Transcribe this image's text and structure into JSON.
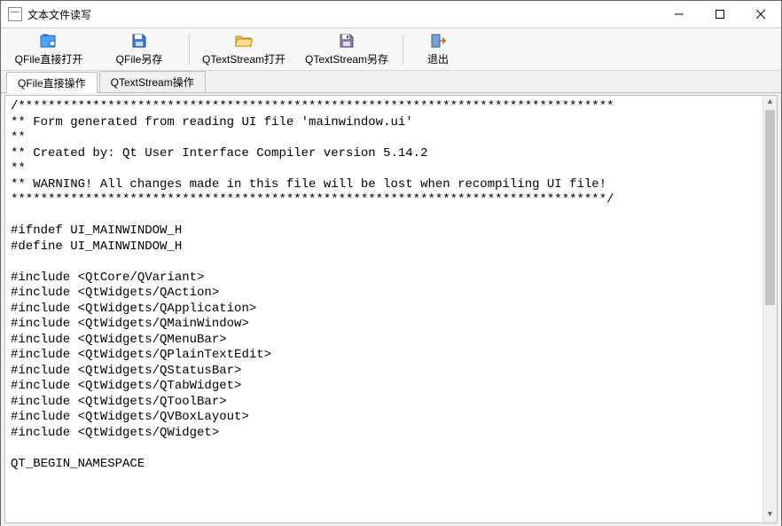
{
  "window": {
    "title": "文本文件读写"
  },
  "toolbar": {
    "qfile_open_label": "QFile直接打开",
    "qfile_save_label": "QFile另存",
    "qts_open_label": "QTextStream打开",
    "qts_save_label": "QTextStream另存",
    "exit_label": "退出"
  },
  "tabs": {
    "qfile_tab": "QFile直接操作",
    "qts_tab": "QTextStream操作"
  },
  "editor": {
    "content": "/********************************************************************************\n** Form generated from reading UI file 'mainwindow.ui'\n**\n** Created by: Qt User Interface Compiler version 5.14.2\n**\n** WARNING! All changes made in this file will be lost when recompiling UI file!\n********************************************************************************/\n\n#ifndef UI_MAINWINDOW_H\n#define UI_MAINWINDOW_H\n\n#include <QtCore/QVariant>\n#include <QtWidgets/QAction>\n#include <QtWidgets/QApplication>\n#include <QtWidgets/QMainWindow>\n#include <QtWidgets/QMenuBar>\n#include <QtWidgets/QPlainTextEdit>\n#include <QtWidgets/QStatusBar>\n#include <QtWidgets/QTabWidget>\n#include <QtWidgets/QToolBar>\n#include <QtWidgets/QVBoxLayout>\n#include <QtWidgets/QWidget>\n\nQT_BEGIN_NAMESPACE\n"
  }
}
